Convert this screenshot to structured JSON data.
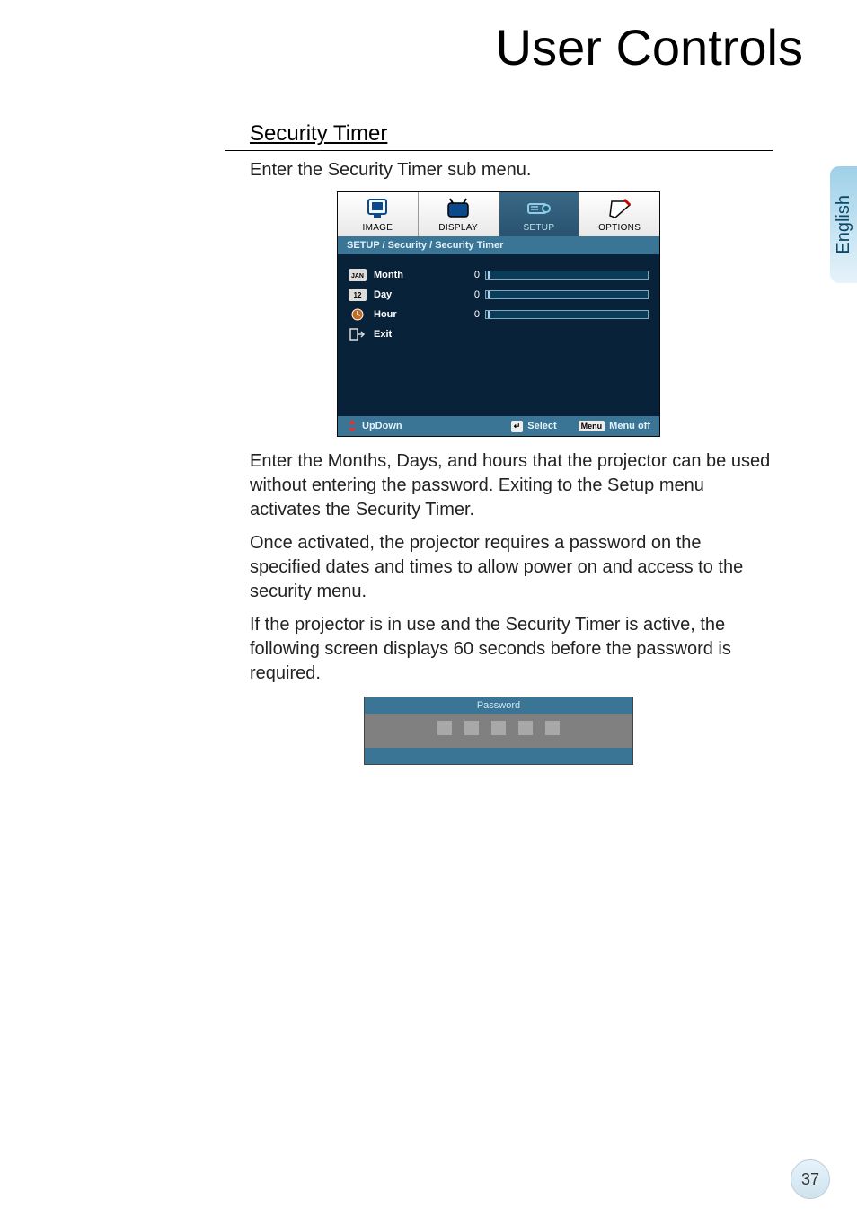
{
  "page": {
    "title": "User Controls",
    "subheading": "Security Timer",
    "intro": "Enter the Security Timer sub menu.",
    "para1": "Enter the Months, Days, and hours that the projector can be used without entering the password. Exiting to the Setup menu activates the Security Timer.",
    "para2": "Once activated, the projector requires a password on the specified dates and times to allow power on and access to the security menu.",
    "para3": "If the projector is in use and the Security Timer is active, the following screen displays 60 seconds before the password is required.",
    "page_number": "37",
    "language_label": "English"
  },
  "osd": {
    "tabs": {
      "image": "IMAGE",
      "display": "DISPLAY",
      "setup": "SETUP",
      "options": "OPTIONS"
    },
    "breadcrumb": "SETUP / Security / Security Timer",
    "rows": {
      "month": {
        "label": "Month",
        "value": "0",
        "icon": "JAN"
      },
      "day": {
        "label": "Day",
        "value": "0",
        "icon": "12"
      },
      "hour": {
        "label": "Hour",
        "value": "0"
      },
      "exit": {
        "label": "Exit"
      }
    },
    "footer": {
      "updown": "UpDown",
      "select": "Select",
      "menu_key": "Menu",
      "menuoff": "Menu off"
    }
  },
  "password_panel": {
    "title": "Password"
  }
}
